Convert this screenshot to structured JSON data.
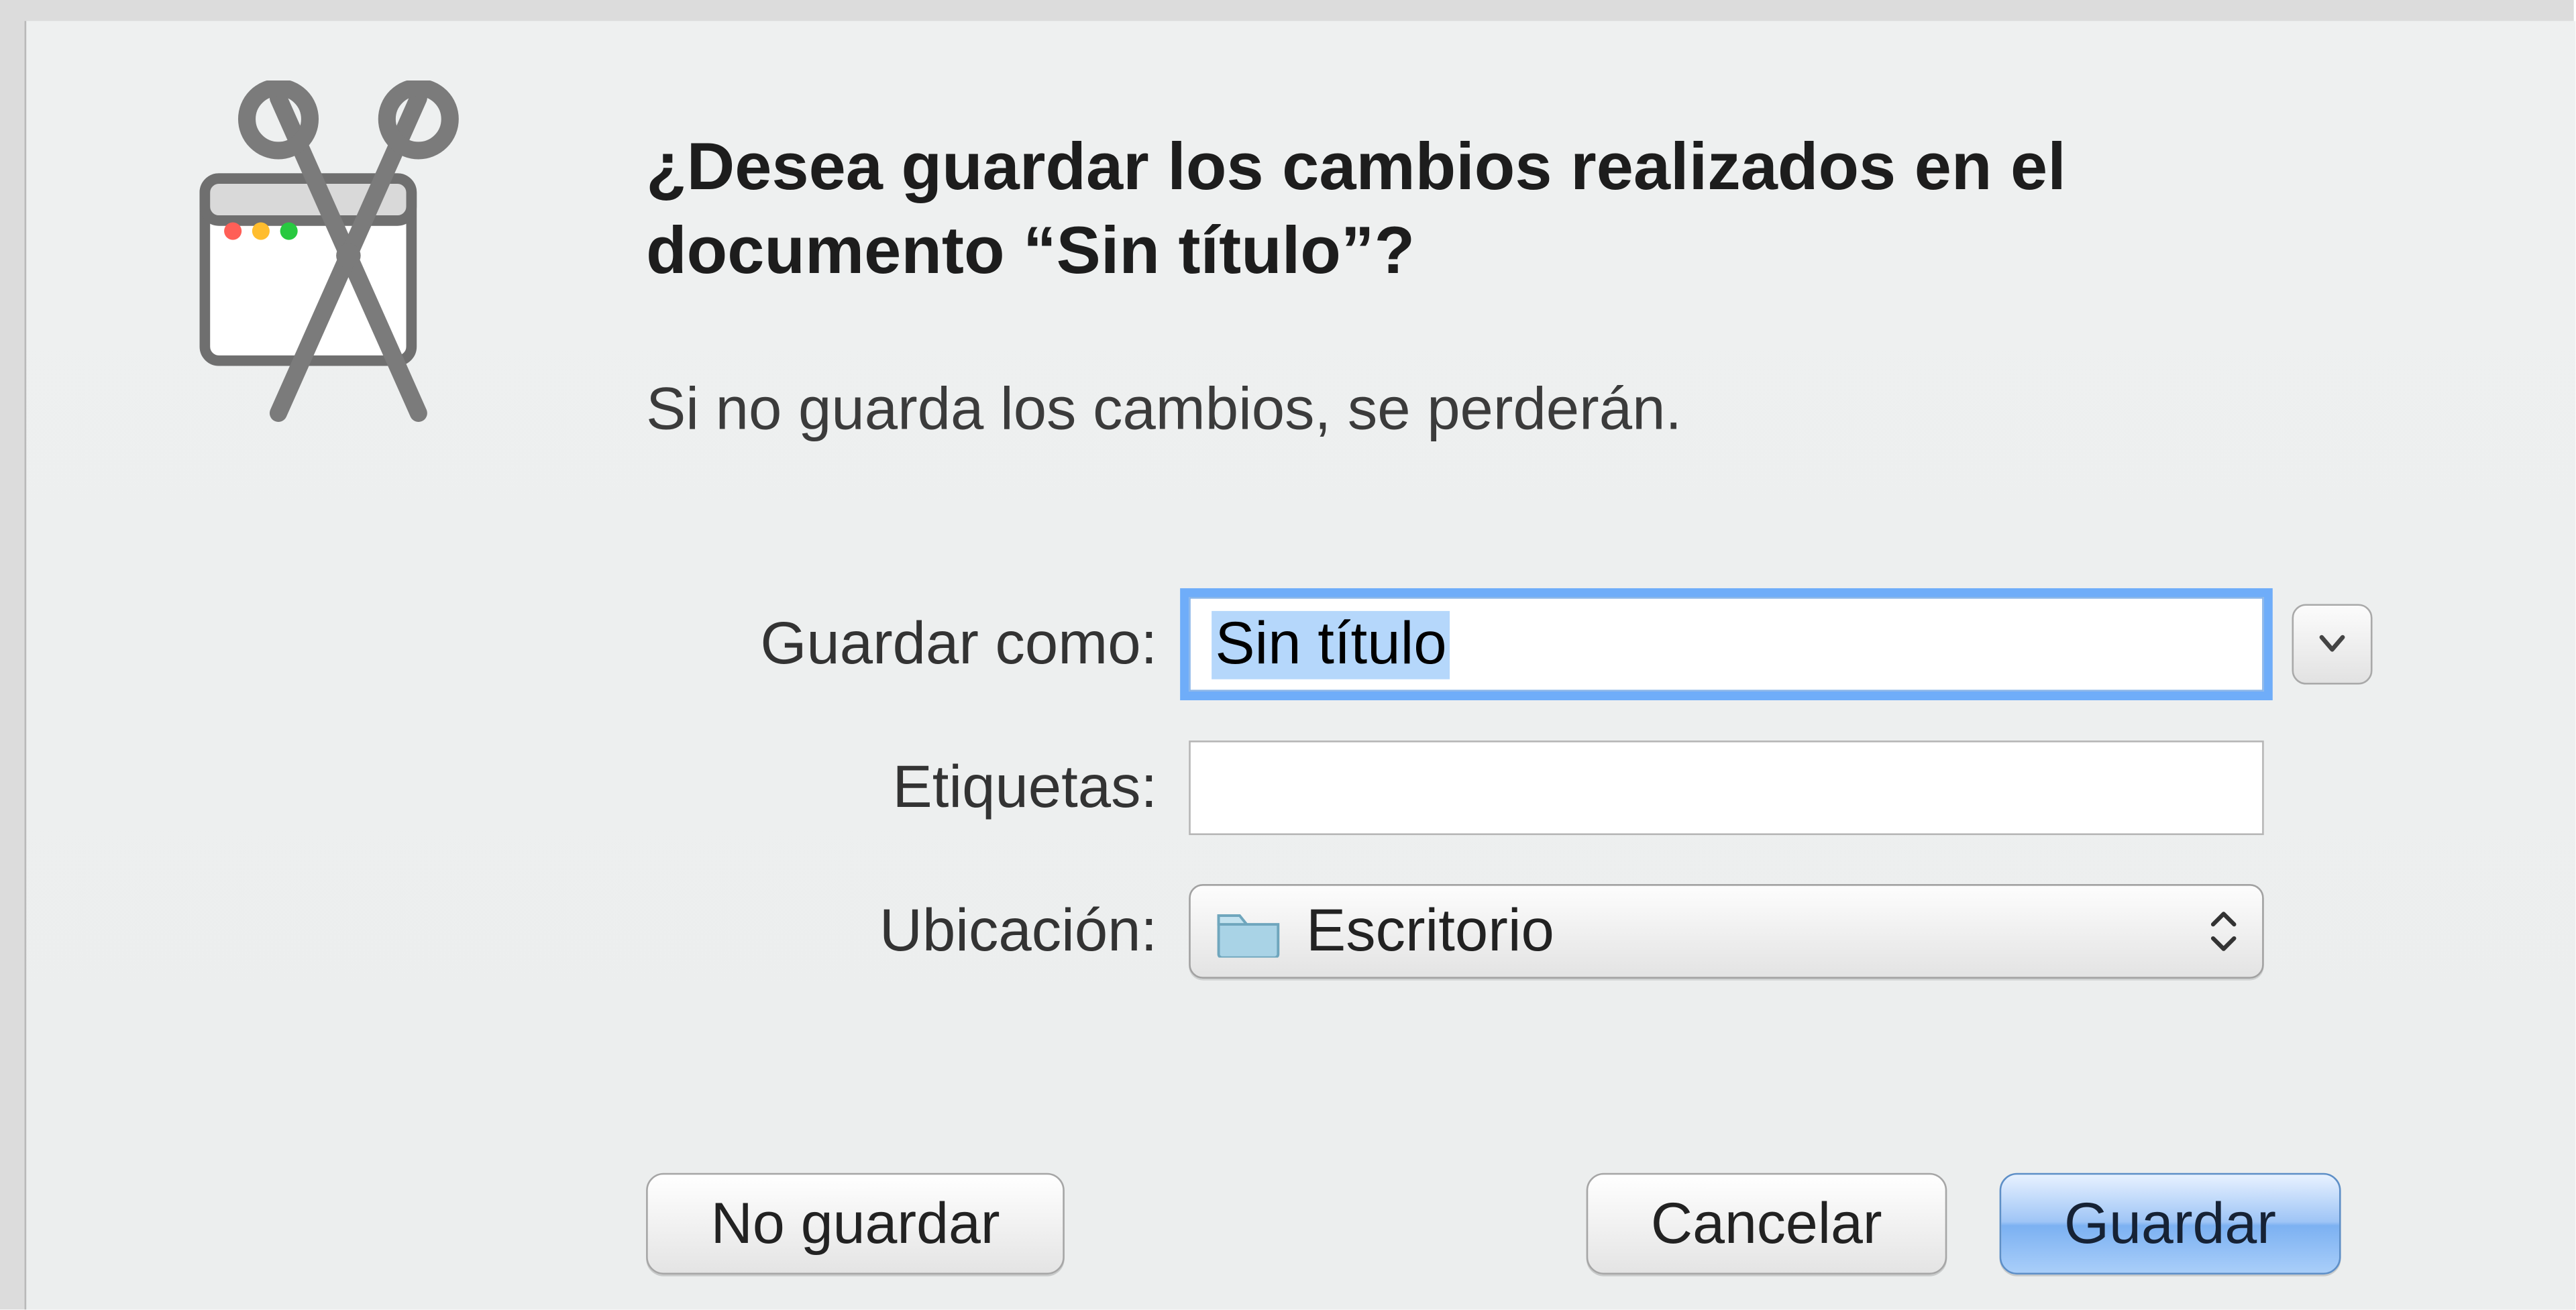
{
  "dialog": {
    "heading": "¿Desea guardar los cambios realizados en el documento “Sin título”?",
    "subheading": "Si no guarda los cambios, se perderán."
  },
  "form": {
    "save_as_label": "Guardar como:",
    "save_as_value": "Sin título",
    "tags_label": "Etiquetas:",
    "tags_value": "",
    "location_label": "Ubicación:",
    "location_value": "Escritorio"
  },
  "buttons": {
    "dont_save": "No guardar",
    "cancel": "Cancelar",
    "save": "Guardar"
  },
  "icons": {
    "app": "screenshot-scissors-icon",
    "folder": "folder-icon",
    "disclosure": "chevron-down-icon",
    "stepper": "up-down-arrows-icon"
  }
}
